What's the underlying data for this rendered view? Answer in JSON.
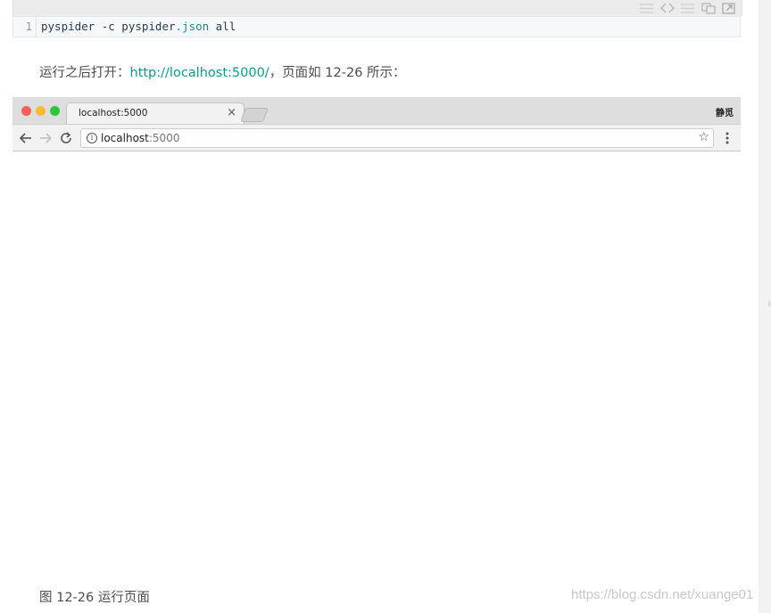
{
  "code_block": {
    "line_number": "1",
    "command_prefix": "pyspider -c pyspider",
    "command_ext": ".json",
    "command_suffix": " all",
    "toolbar_icons": [
      "view-plain-icon",
      "view-source-icon",
      "print-icon",
      "copy-icon",
      "popup-icon"
    ]
  },
  "paragraph": {
    "before": "运行之后打开：",
    "link": "http://localhost:5000/",
    "after": "，页面如 12-26 所示："
  },
  "browser": {
    "traffic_lights": [
      "#fc5d57",
      "#fdbc2e",
      "#2ac840"
    ],
    "tab_title": "localhost:5000",
    "tab_close": "×",
    "profile_label": "静觅",
    "url_host": "localhost",
    "url_port": ":5000",
    "info_glyph": "i",
    "star_glyph": "☆"
  },
  "caption": "图 12-26 运行页面",
  "watermark": "https://blog.csdn.net/xuange01"
}
